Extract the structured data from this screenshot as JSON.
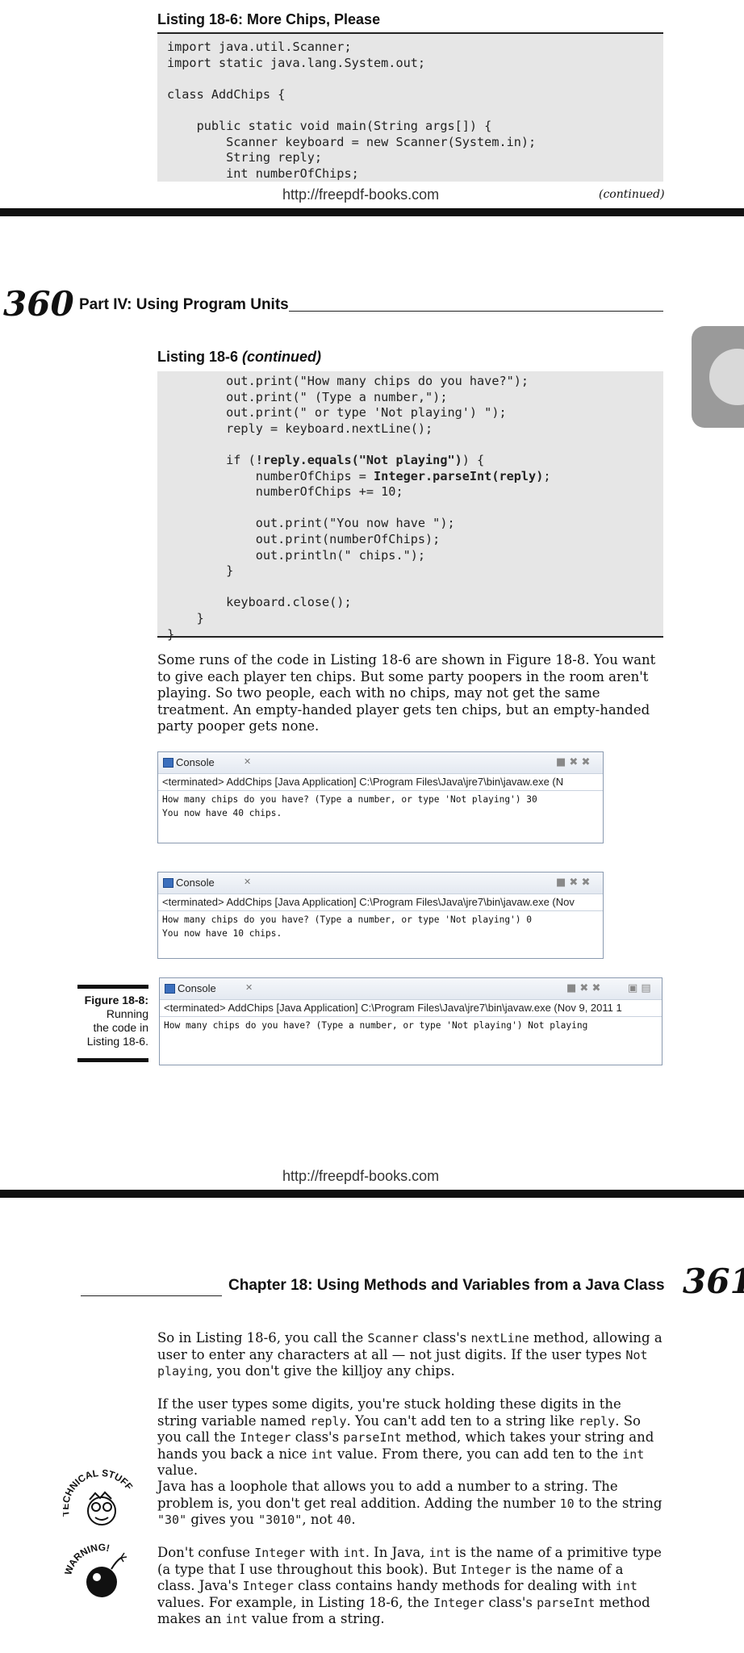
{
  "top_page": {
    "listing_title": "Listing 18-6:   More Chips, Please",
    "code": "import java.util.Scanner;\nimport static java.lang.System.out;\n\nclass AddChips {\n\n    public static void main(String args[]) {\n        Scanner keyboard = new Scanner(System.in);\n        String reply;\n        int numberOfChips;",
    "footer_link": "http://freepdf-books.com",
    "continued": "(continued)"
  },
  "page360": {
    "page_number": "360",
    "running_head": "Part IV: Using Program Units",
    "listing_title": "Listing 18-6 ",
    "listing_title_italic": "(continued)",
    "code_lines": [
      {
        "pre": "        out.print(\"How many chips do you have?\");",
        "b": "",
        "post": ""
      },
      {
        "pre": "        out.print(\" (Type a number,\");",
        "b": "",
        "post": ""
      },
      {
        "pre": "        out.print(\" or type 'Not playing') \");",
        "b": "",
        "post": ""
      },
      {
        "pre": "        reply = keyboard.nextLine();",
        "b": "",
        "post": ""
      },
      {
        "pre": "",
        "b": "",
        "post": ""
      },
      {
        "pre": "        if (",
        "b": "!reply.equals(\"Not playing\")",
        "post": ") {"
      },
      {
        "pre": "            numberOfChips = ",
        "b": "Integer.parseInt(reply)",
        "post": ";"
      },
      {
        "pre": "            numberOfChips += 10;",
        "b": "",
        "post": ""
      },
      {
        "pre": "",
        "b": "",
        "post": ""
      },
      {
        "pre": "            out.print(\"You now have \");",
        "b": "",
        "post": ""
      },
      {
        "pre": "            out.print(numberOfChips);",
        "b": "",
        "post": ""
      },
      {
        "pre": "            out.println(\" chips.\");",
        "b": "",
        "post": ""
      },
      {
        "pre": "        }",
        "b": "",
        "post": ""
      },
      {
        "pre": "",
        "b": "",
        "post": ""
      },
      {
        "pre": "        keyboard.close();",
        "b": "",
        "post": ""
      },
      {
        "pre": "    }",
        "b": "",
        "post": ""
      },
      {
        "pre": "}",
        "b": "",
        "post": ""
      }
    ],
    "para": "Some runs of the code in Listing 18-6 are shown in Figure 18-8. You want to give each player ten chips. But some party poopers in the room aren't playing. So two people, each with no chips, may not get the same treatment. An empty-handed player gets ten chips, but an empty-handed party pooper gets none.",
    "consoles": [
      {
        "tab": "Console",
        "terminated": "<terminated> AddChips [Java Application] C:\\Program Files\\Java\\jre7\\bin\\javaw.exe (N",
        "lines": [
          "How many chips do you have? (Type a number, or type 'Not playing') 30",
          "You now have 40 chips."
        ]
      },
      {
        "tab": "Console",
        "terminated": "<terminated> AddChips [Java Application] C:\\Program Files\\Java\\jre7\\bin\\javaw.exe (Nov",
        "lines": [
          "How many chips do you have? (Type a number, or type 'Not playing') 0",
          "You now have 10 chips."
        ]
      },
      {
        "tab": "Console",
        "terminated": "<terminated> AddChips [Java Application] C:\\Program Files\\Java\\jre7\\bin\\javaw.exe (Nov 9, 2011 1",
        "lines": [
          "How many chips do you have? (Type a number, or type 'Not playing') Not playing"
        ]
      }
    ],
    "figure_label": "Figure 18-8:",
    "figure_caption_lines": [
      "Running",
      "the code in",
      "Listing 18-6."
    ],
    "footer_link": "http://freepdf-books.com"
  },
  "page361": {
    "running_head": "Chapter 18: Using Methods and Variables from a Java Class",
    "page_number": "361",
    "p1": [
      {
        "t": "So in Listing 18-6, you call the "
      },
      {
        "m": "Scanner"
      },
      {
        "t": " class's "
      },
      {
        "m": "nextLine"
      },
      {
        "t": " method, allowing a user to enter any characters at all — not just digits. If the user types "
      },
      {
        "m": "Not playing"
      },
      {
        "t": ", you don't give the killjoy any chips."
      }
    ],
    "p2": [
      {
        "t": "If the user types some digits, you're stuck holding these digits in the string variable named "
      },
      {
        "m": "reply"
      },
      {
        "t": ". You can't add ten to a string like "
      },
      {
        "m": "reply"
      },
      {
        "t": ". So you call the "
      },
      {
        "m": "Integer"
      },
      {
        "t": " class's "
      },
      {
        "m": "parseInt"
      },
      {
        "t": " method, which takes your string and hands you back a nice "
      },
      {
        "m": "int"
      },
      {
        "t": " value. From there, you can add ten to the "
      },
      {
        "m": "int"
      },
      {
        "t": " value."
      }
    ],
    "p3": [
      {
        "t": "Java has a loophole that allows you to add a number to a string. The problem is, you don't get real addition. Adding the number "
      },
      {
        "m": "10"
      },
      {
        "t": " to the string "
      },
      {
        "m": "\"30\""
      },
      {
        "t": " gives you "
      },
      {
        "m": "\"3010\""
      },
      {
        "t": ", not "
      },
      {
        "m": "40"
      },
      {
        "t": "."
      }
    ],
    "p4": [
      {
        "t": "Don't confuse "
      },
      {
        "m": "Integer"
      },
      {
        "t": " with "
      },
      {
        "m": "int"
      },
      {
        "t": ". In Java, "
      },
      {
        "m": "int"
      },
      {
        "t": " is the name of a primitive type (a type that I use throughout this book). But "
      },
      {
        "m": "Integer"
      },
      {
        "t": " is the name of a class. Java's "
      },
      {
        "m": "Integer"
      },
      {
        "t": " class contains handy methods for dealing with "
      },
      {
        "m": "int"
      },
      {
        "t": " values. For example, in Listing 18-6, the "
      },
      {
        "m": "Integer"
      },
      {
        "t": " class's "
      },
      {
        "m": "parseInt"
      },
      {
        "t": " method makes an "
      },
      {
        "m": "int"
      },
      {
        "t": " value from a string."
      }
    ],
    "icon_technical_label": "TECHNICAL STUFF",
    "icon_warning_label": "WARNING!"
  }
}
